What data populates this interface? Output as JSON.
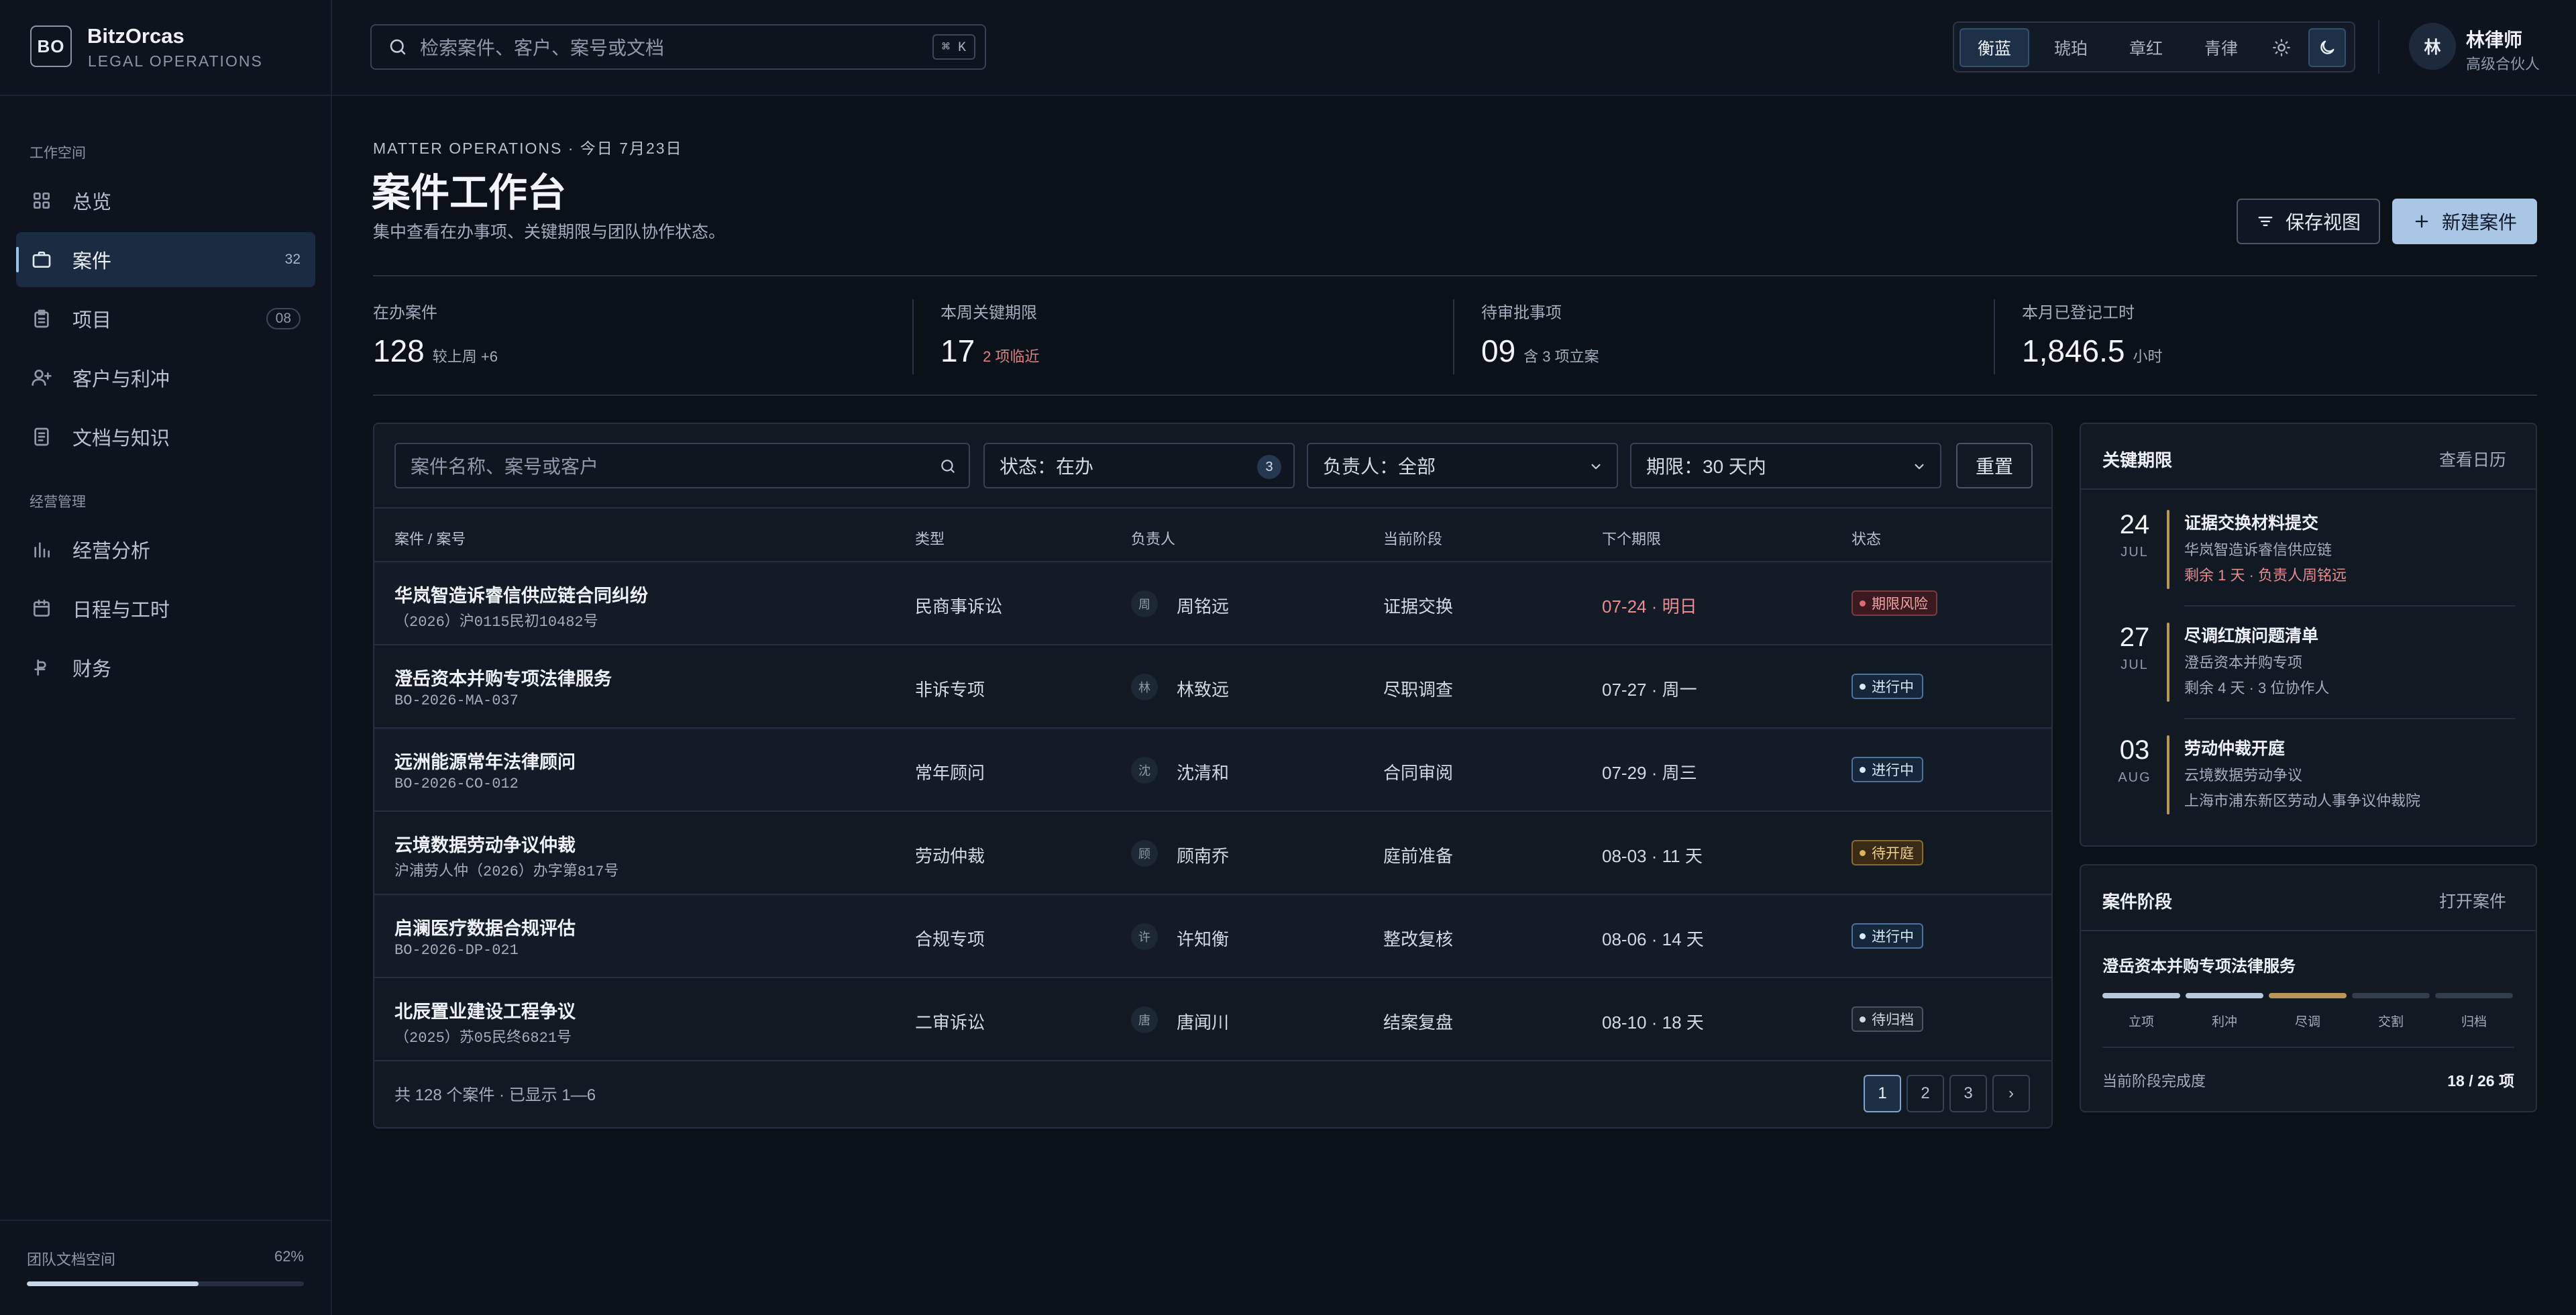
{
  "brand": {
    "logo": "BO",
    "name": "BitzOrcas",
    "subtitle": "LEGAL OPERATIONS"
  },
  "sidebar": {
    "sections": [
      {
        "title": "工作空间",
        "items": [
          {
            "label": "总览",
            "icon": "grid-icon",
            "count": ""
          },
          {
            "label": "案件",
            "icon": "briefcase-icon",
            "count": "32",
            "active": true
          },
          {
            "label": "项目",
            "icon": "clipboard-icon",
            "count": "08"
          },
          {
            "label": "客户与利冲",
            "icon": "user-plus-icon",
            "count": ""
          },
          {
            "label": "文档与知识",
            "icon": "document-icon",
            "count": ""
          }
        ]
      },
      {
        "title": "经营管理",
        "items": [
          {
            "label": "经营分析",
            "icon": "bar-chart-icon",
            "count": ""
          },
          {
            "label": "日程与工时",
            "icon": "calendar-icon",
            "count": ""
          },
          {
            "label": "财务",
            "icon": "currency-icon",
            "count": ""
          }
        ]
      }
    ],
    "storage": {
      "label": "团队文档空间",
      "percent_label": "62%",
      "percent": 62
    }
  },
  "header": {
    "search_placeholder": "检索案件、客户、案号或文档",
    "search_shortcut": "⌘ K",
    "themes": [
      "衡蓝",
      "琥珀",
      "章红",
      "青律"
    ],
    "active_theme": "衡蓝",
    "user": {
      "avatar": "林",
      "name": "林律师",
      "role": "高级合伙人"
    }
  },
  "page": {
    "eyebrow": "MATTER OPERATIONS · 今日 7月23日",
    "title": "案件工作台",
    "description": "集中查看在办事项、关键期限与团队协作状态。",
    "save_view": "保存视图",
    "new_matter": "新建案件"
  },
  "stats": [
    {
      "label": "在办案件",
      "value": "128",
      "note": "较上周 +6",
      "tone": "neutral"
    },
    {
      "label": "本周关键期限",
      "value": "17",
      "note": "2 项临近",
      "tone": "red"
    },
    {
      "label": "待审批事项",
      "value": "09",
      "note": "含 3 项立案",
      "tone": "neutral"
    },
    {
      "label": "本月已登记工时",
      "value": "1,846.5",
      "note": "小时",
      "tone": "neutral"
    }
  ],
  "filters": {
    "search_placeholder": "案件名称、案号或客户",
    "status": "状态：在办",
    "status_count": "3",
    "owner": "负责人：全部",
    "deadline": "期限：30 天内",
    "reset": "重置"
  },
  "table": {
    "columns": [
      "案件 / 案号",
      "类型",
      "负责人",
      "当前阶段",
      "下个期限",
      "状态"
    ],
    "rows": [
      {
        "name": "华岚智造诉睿信供应链合同纠纷",
        "no": "（2026）沪0115民初10482号",
        "type": "民商事诉讼",
        "owner_initial": "周",
        "owner": "周铭远",
        "stage": "证据交换",
        "deadline": "07-24 · 明日",
        "urgent": true,
        "status": "期限风险",
        "status_tone": "red"
      },
      {
        "name": "澄岳资本并购专项法律服务",
        "no": "BO-2026-MA-037",
        "type": "非诉专项",
        "owner_initial": "林",
        "owner": "林致远",
        "stage": "尽职调查",
        "deadline": "07-27 · 周一",
        "urgent": false,
        "status": "进行中",
        "status_tone": "blue"
      },
      {
        "name": "远洲能源常年法律顾问",
        "no": "BO-2026-CO-012",
        "type": "常年顾问",
        "owner_initial": "沈",
        "owner": "沈清和",
        "stage": "合同审阅",
        "deadline": "07-29 · 周三",
        "urgent": false,
        "status": "进行中",
        "status_tone": "blue"
      },
      {
        "name": "云境数据劳动争议仲裁",
        "no": "沪浦劳人仲（2026）办字第817号",
        "type": "劳动仲裁",
        "owner_initial": "顾",
        "owner": "顾南乔",
        "stage": "庭前准备",
        "deadline": "08-03 · 11 天",
        "urgent": false,
        "status": "待开庭",
        "status_tone": "amber"
      },
      {
        "name": "启澜医疗数据合规评估",
        "no": "BO-2026-DP-021",
        "type": "合规专项",
        "owner_initial": "许",
        "owner": "许知衡",
        "stage": "整改复核",
        "deadline": "08-06 · 14 天",
        "urgent": false,
        "status": "进行中",
        "status_tone": "blue"
      },
      {
        "name": "北辰置业建设工程争议",
        "no": "（2025）苏05民终6821号",
        "type": "二审诉讼",
        "owner_initial": "唐",
        "owner": "唐闻川",
        "stage": "结案复盘",
        "deadline": "08-10 · 18 天",
        "urgent": false,
        "status": "待归档",
        "status_tone": "gray"
      }
    ],
    "footer": "共 128 个案件 · 已显示 1—6",
    "pages": [
      "1",
      "2",
      "3"
    ],
    "next": "›"
  },
  "deadlines": {
    "title": "关键期限",
    "link": "查看日历",
    "items": [
      {
        "day": "24",
        "month": "JUL",
        "title": "证据交换材料提交",
        "sub": "华岚智造诉睿信供应链",
        "note": "剩余 1 天 · 负责人周铭远",
        "urgent": true
      },
      {
        "day": "27",
        "month": "JUL",
        "title": "尽调红旗问题清单",
        "sub": "澄岳资本并购专项",
        "note": "剩余 4 天 · 3 位协作人",
        "urgent": false
      },
      {
        "day": "03",
        "month": "AUG",
        "title": "劳动仲裁开庭",
        "sub": "云境数据劳动争议",
        "note": "上海市浦东新区劳动人事争议仲裁院",
        "urgent": false
      }
    ]
  },
  "stage": {
    "title": "案件阶段",
    "link": "打开案件",
    "matter": "澄岳资本并购专项法律服务",
    "steps": [
      {
        "label": "立项",
        "state": "done"
      },
      {
        "label": "利冲",
        "state": "done"
      },
      {
        "label": "尽调",
        "state": "current"
      },
      {
        "label": "交割",
        "state": "todo"
      },
      {
        "label": "归档",
        "state": "todo"
      }
    ],
    "progress_label": "当前阶段完成度",
    "progress_value": "18 / 26 项"
  },
  "colors": {
    "accent": "#a9c6e6",
    "amber": "#b99558",
    "red": "#e07e82",
    "bg": "#0b1119"
  }
}
